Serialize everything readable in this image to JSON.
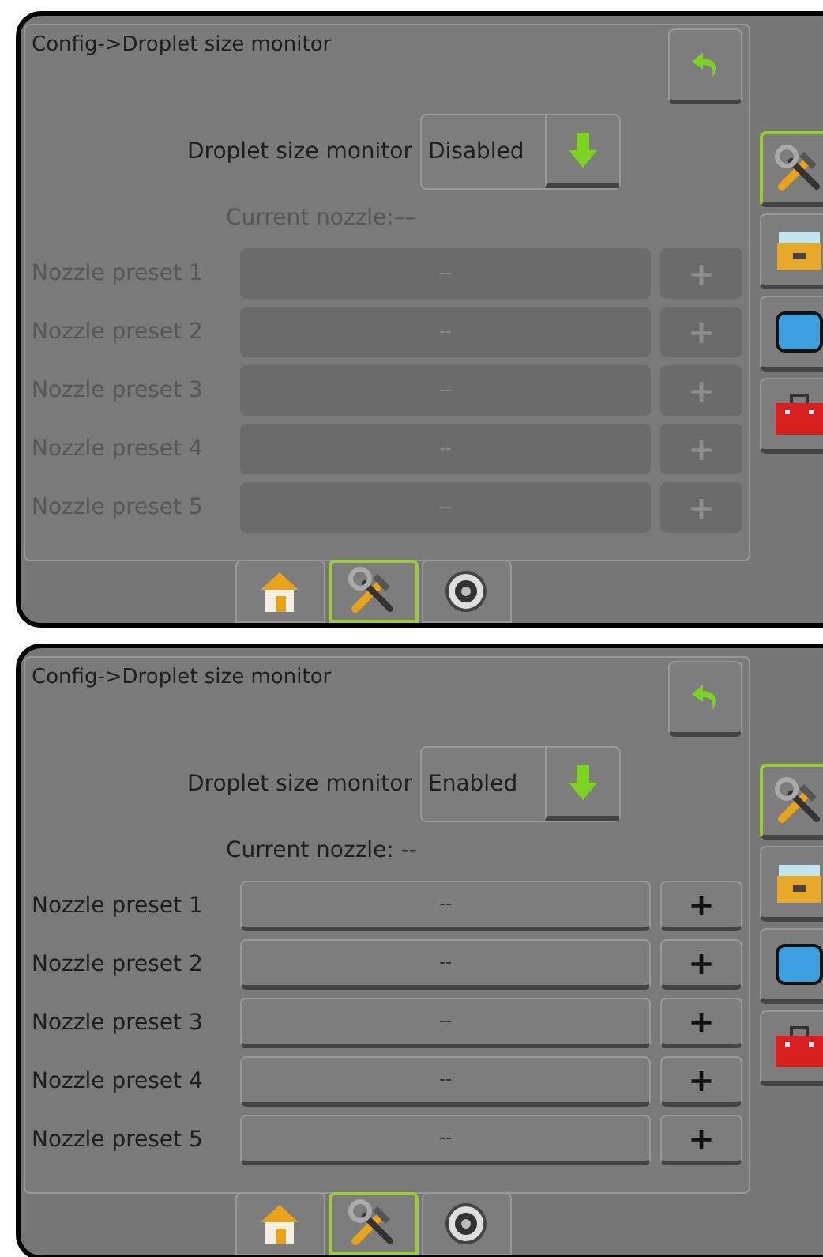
{
  "screens": [
    {
      "title": "Config->Droplet size monitor",
      "enabled": false,
      "monitor": {
        "label": "Droplet size monitor",
        "value": "Disabled"
      },
      "current_nozzle": "Current nozzle:––",
      "presets": [
        {
          "label": "Nozzle preset 1",
          "value": "--",
          "add": "+"
        },
        {
          "label": "Nozzle preset 2",
          "value": "--",
          "add": "+"
        },
        {
          "label": "Nozzle preset 3",
          "value": "--",
          "add": "+"
        },
        {
          "label": "Nozzle preset 4",
          "value": "--",
          "add": "+"
        },
        {
          "label": "Nozzle preset 5",
          "value": "--",
          "add": "+"
        }
      ],
      "side_tabs": [
        {
          "kind": "tools",
          "selected": true
        },
        {
          "kind": "drawer",
          "selected": false
        },
        {
          "kind": "screen",
          "selected": false
        },
        {
          "kind": "toolbox",
          "selected": false
        }
      ],
      "bottom_tabs": [
        {
          "kind": "home",
          "selected": false
        },
        {
          "kind": "tools",
          "selected": true
        },
        {
          "kind": "disc",
          "selected": false
        }
      ]
    },
    {
      "title": "Config->Droplet size monitor",
      "enabled": true,
      "monitor": {
        "label": "Droplet size monitor",
        "value": "Enabled"
      },
      "current_nozzle": "Current nozzle: --",
      "presets": [
        {
          "label": "Nozzle preset 1",
          "value": "--",
          "add": "+"
        },
        {
          "label": "Nozzle preset 2",
          "value": "--",
          "add": "+"
        },
        {
          "label": "Nozzle preset 3",
          "value": "--",
          "add": "+"
        },
        {
          "label": "Nozzle preset 4",
          "value": "--",
          "add": "+"
        },
        {
          "label": "Nozzle preset 5",
          "value": "--",
          "add": "+"
        }
      ],
      "side_tabs": [
        {
          "kind": "tools",
          "selected": true
        },
        {
          "kind": "drawer",
          "selected": false
        },
        {
          "kind": "screen",
          "selected": false
        },
        {
          "kind": "toolbox",
          "selected": false
        }
      ],
      "bottom_tabs": [
        {
          "kind": "home",
          "selected": false
        },
        {
          "kind": "tools",
          "selected": true
        },
        {
          "kind": "disc",
          "selected": false
        }
      ]
    }
  ]
}
